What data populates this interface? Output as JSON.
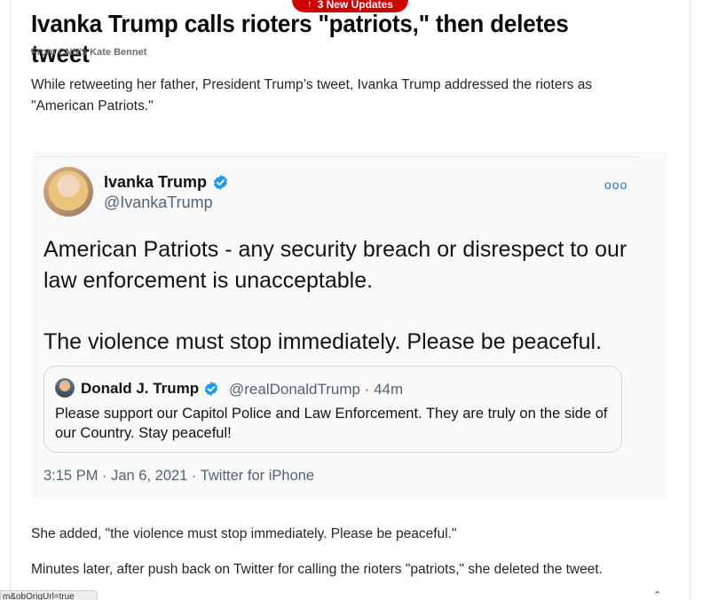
{
  "banner": {
    "label": "3 New Updates",
    "arrow": "↑"
  },
  "article": {
    "headline": "Ivanka Trump calls rioters \"patriots,\" then deletes tweet",
    "byline": "From CNN's Kate Bennet",
    "paragraph1": "While retweeting her father, President Trump’s tweet, Ivanka Trump addressed the rioters as \"American Patriots.\"",
    "paragraph2": "She added, \"the violence must stop immediately. Please be peaceful.\"",
    "paragraph3": "Minutes later, after push back on Twitter for calling the rioters \"patriots,\" she deleted the tweet."
  },
  "tweet": {
    "author_name": "Ivanka Trump",
    "author_handle": "@IvankaTrump",
    "more": "ooo",
    "text_line1": "American Patriots - any security breach or disrespect to our law enforcement is unacceptable.",
    "text_line2": "The violence must stop immediately. Please be peaceful.",
    "quoted": {
      "author_name": "Donald J. Trump",
      "author_handle": "@realDonaldTrump · 44m",
      "text": "Please support our Capitol Police and Law Enforcement. They are truly on the side of our Country. Stay peaceful!"
    },
    "meta": "3:15 PM · Jan 6, 2021 · Twitter for iPhone"
  },
  "status_bar": {
    "url_text": "m&obOrigUrl=true"
  },
  "colors": {
    "accent": "#cc0000",
    "verified": "#1d9bf0",
    "twitter_link": "#1d6fd0"
  },
  "icons": [
    "arrow-up-icon",
    "verified-badge-icon",
    "more-options-icon",
    "avatar-ivanka",
    "avatar-donald",
    "scroll-caret-icon"
  ]
}
